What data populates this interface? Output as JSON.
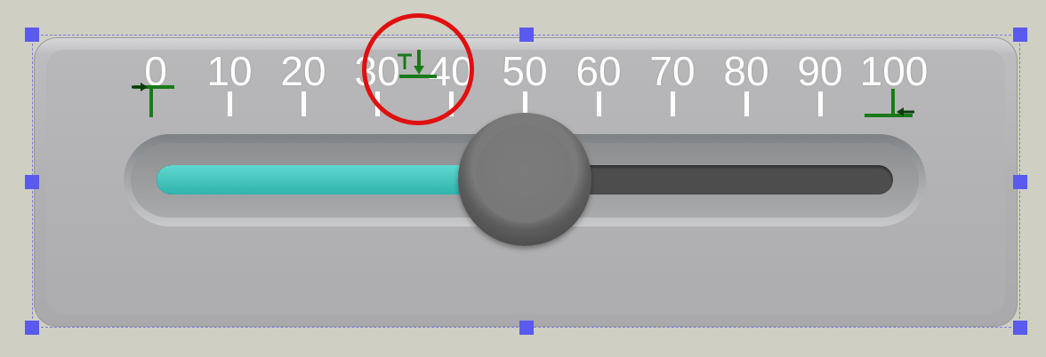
{
  "slider": {
    "min": 0,
    "max": 100,
    "value": 50,
    "scale_labels": [
      "0",
      "10",
      "20",
      "30",
      "40",
      "50",
      "60",
      "70",
      "80",
      "90",
      "100"
    ],
    "fill_color": "#36bdb5",
    "track_color": "#4d4d4d",
    "thumb_color": "#777777"
  },
  "selection": {
    "handle_color": "#5a5aee",
    "frame_color": "#7d7ddb"
  },
  "markers": {
    "start_icon": "range-start-marker-icon",
    "end_icon": "range-end-marker-icon",
    "current_icon": "current-value-marker-icon",
    "color": "#1a7a1a"
  },
  "highlight": {
    "color": "#e01010"
  }
}
